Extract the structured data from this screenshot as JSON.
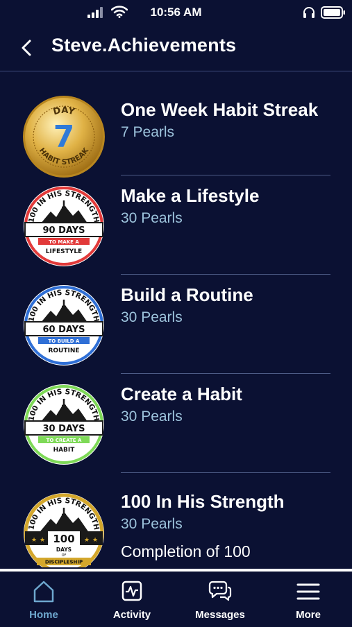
{
  "status_bar": {
    "time": "10:56 AM",
    "icons": [
      "signal-icon",
      "wifi-icon",
      "headphones-icon",
      "battery-icon"
    ]
  },
  "header": {
    "back_icon": "chevron-left-icon",
    "title": "Steve.Achievements"
  },
  "achievements": [
    {
      "title": "One Week Habit Streak",
      "reward": "7 Pearls",
      "badge": {
        "type": "seal",
        "top_text": "DAY",
        "number": "7",
        "bottom_text": "HABIT STREAK",
        "color": "#d8a63a"
      }
    },
    {
      "title": "Make a Lifestyle",
      "reward": "30 Pearls",
      "badge": {
        "type": "banner",
        "arc_text": "100 IN HIS STRENGTH",
        "days": "90 DAYS",
        "small": "TO MAKE A",
        "bottom": "LIFESTYLE",
        "color": "#e23a3a"
      }
    },
    {
      "title": "Build a Routine",
      "reward": "30 Pearls",
      "badge": {
        "type": "banner",
        "arc_text": "100 IN HIS STRENGTH",
        "days": "60 DAYS",
        "small": "TO BUILD A",
        "bottom": "ROUTINE",
        "color": "#2f6fd6"
      }
    },
    {
      "title": "Create a Habit",
      "reward": "30 Pearls",
      "badge": {
        "type": "banner",
        "arc_text": "100 IN HIS STRENGTH",
        "days": "30 DAYS",
        "small": "TO CREATE A",
        "bottom": "HABIT",
        "color": "#7ed957"
      }
    },
    {
      "title": "100 In His Strength",
      "reward": "30 Pearls",
      "description": "Completion of 100",
      "badge": {
        "type": "gold-banner",
        "arc_text": "100 IN HIS STRENGTH",
        "days": "100",
        "small": "DAYS",
        "tiny": "OF",
        "bottom": "DISCIPLESHIP",
        "color": "#d4a72c"
      }
    }
  ],
  "tabbar": {
    "tabs": [
      {
        "label": "Home",
        "icon": "home-icon",
        "active": true
      },
      {
        "label": "Activity",
        "icon": "activity-icon",
        "active": false
      },
      {
        "label": "Messages",
        "icon": "messages-icon",
        "active": false
      },
      {
        "label": "More",
        "icon": "menu-icon",
        "active": false
      }
    ],
    "active_color": "#6ea8cf",
    "inactive_color": "#ffffff"
  }
}
